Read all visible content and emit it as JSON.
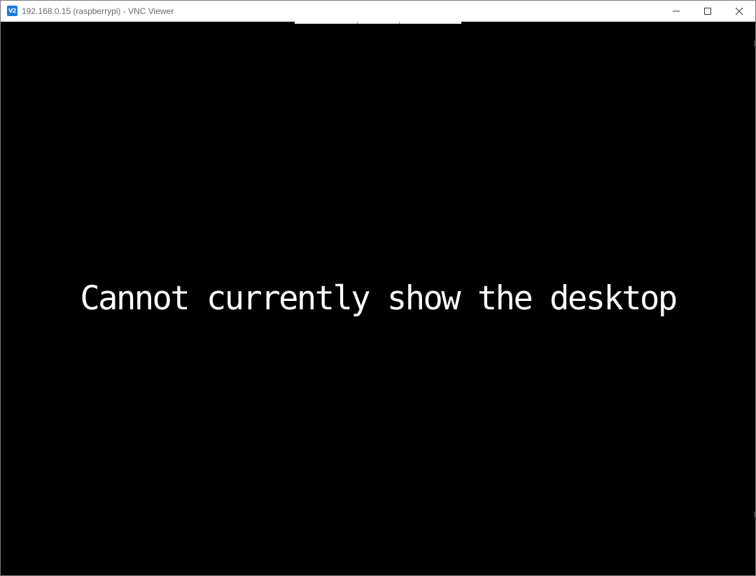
{
  "window": {
    "title": "192.168.0.15 (raspberrypi) - VNC Viewer",
    "icon": "vnc-viewer-icon",
    "icon_label": "V2",
    "controls": {
      "minimize": "minimize-icon",
      "maximize": "maximize-icon",
      "close": "close-icon"
    }
  },
  "viewer": {
    "background": "#000000",
    "message": "Cannot currently show the desktop",
    "message_color": "#ffffff"
  }
}
